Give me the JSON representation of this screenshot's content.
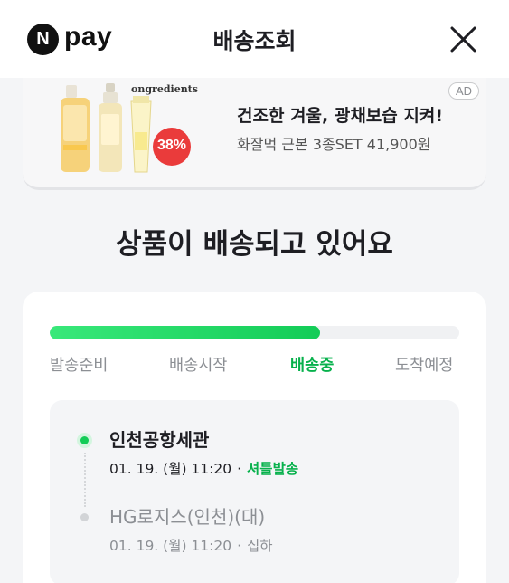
{
  "header": {
    "logo_mark": "N",
    "logo_text": "pay",
    "title": "배송조회"
  },
  "ad": {
    "brand": "ongredients",
    "discount": "38%",
    "headline": "건조한 겨울, 광채보습 지켜!",
    "subline": "화잘먹 근본 3종SET 41,900원",
    "badge": "AD"
  },
  "status": {
    "title": "상품이 배송되고 있어요"
  },
  "progress": {
    "fraction": 0.66,
    "steps": [
      "발송준비",
      "배송시작",
      "배송중",
      "도착예정"
    ],
    "active_step": 2
  },
  "timeline": [
    {
      "place": "인천공항세관",
      "time": "01. 19. (월) 11:20",
      "event": "셔틀발송",
      "current": true
    },
    {
      "place": "HG로지스(인천)(대)",
      "time": "01. 19. (월) 11:20",
      "event": "집하",
      "current": false
    }
  ],
  "colors": {
    "accent": "#07b14c",
    "progress": "#13cc57",
    "muted": "#8c8f94"
  }
}
